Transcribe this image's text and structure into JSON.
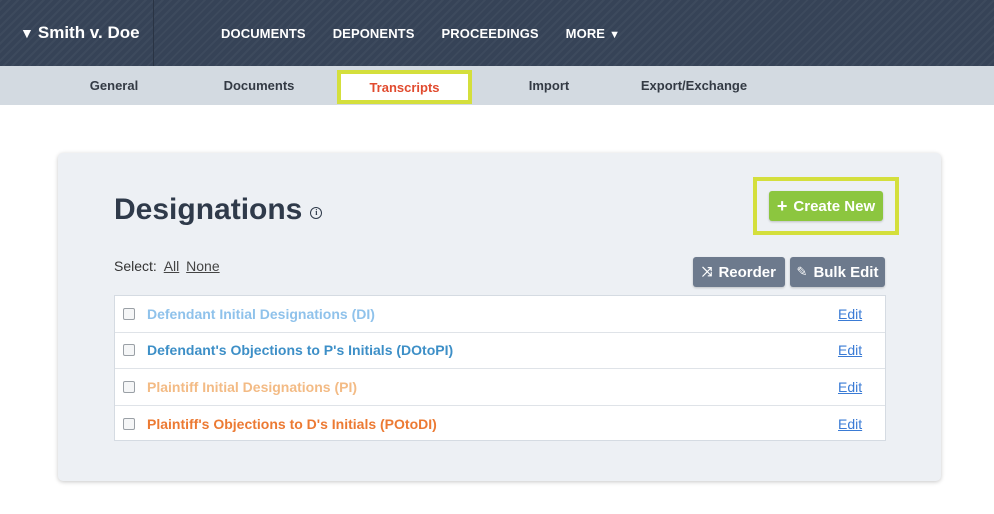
{
  "header": {
    "case_title": "Smith v. Doe",
    "nav": [
      {
        "label": "DOCUMENTS"
      },
      {
        "label": "DEPONENTS"
      },
      {
        "label": "PROCEEDINGS"
      },
      {
        "label": "MORE"
      }
    ]
  },
  "subnav": {
    "tabs": [
      {
        "label": "General"
      },
      {
        "label": "Documents"
      },
      {
        "label": "Transcripts"
      },
      {
        "label": "Import"
      },
      {
        "label": "Export/Exchange"
      }
    ],
    "active": "Transcripts"
  },
  "designations": {
    "title": "Designations",
    "create_label": "Create New",
    "select_label": "Select:",
    "select_all": "All",
    "select_none": "None",
    "reorder_label": "Reorder",
    "bulk_edit_label": "Bulk Edit",
    "items": [
      {
        "label": "Defendant Initial Designations (DI)",
        "color": "#8fc2eb",
        "checked": false,
        "edit": "Edit"
      },
      {
        "label": "Defendant's Objections to P's Initials (DOtoPI)",
        "color": "#3d8fc7",
        "checked": false,
        "edit": "Edit"
      },
      {
        "label": "Plaintiff Initial Designations (PI)",
        "color": "#f3bb85",
        "checked": false,
        "edit": "Edit"
      },
      {
        "label": "Plaintiff's Objections to D's Initials (POtoDI)",
        "color": "#ec7a33",
        "checked": false,
        "edit": "Edit"
      }
    ]
  },
  "colors": {
    "topbar": "#364357",
    "subbar": "#d3dae1",
    "active_tab_text": "#e14b2f",
    "highlight_border": "#d4df3c",
    "create_button": "#8cc63f",
    "action_button": "#6d7a8d",
    "edit_link": "#3a7bd5"
  }
}
